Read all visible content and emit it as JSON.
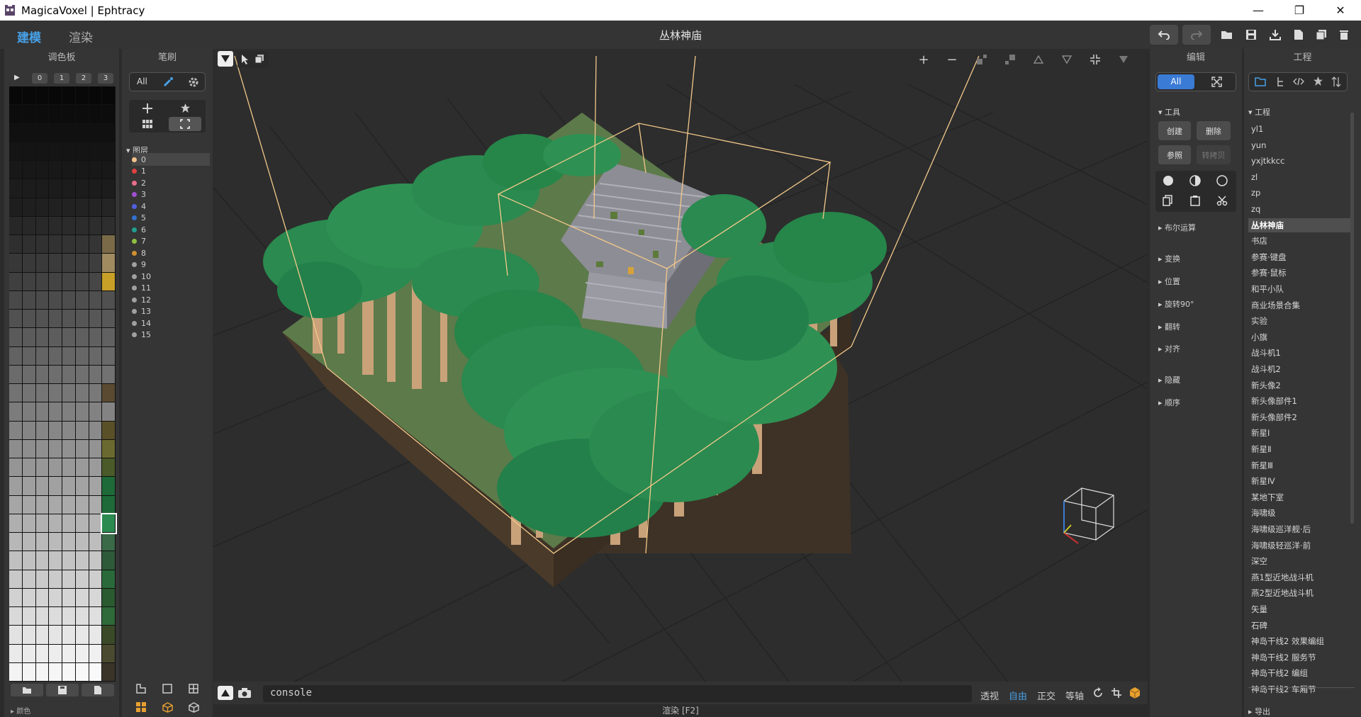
{
  "window": {
    "title": "MagicaVoxel | Ephtracy",
    "minimize": "—",
    "restore": "❐",
    "close": "✕"
  },
  "header": {
    "mode_model": "建模",
    "mode_render": "渲染",
    "project_title": "丛林神庙"
  },
  "palette": {
    "title": "调色板",
    "play": "▶",
    "pages": [
      "0",
      "1",
      "2",
      "3"
    ],
    "footer_label": "▸ 颜色"
  },
  "brush": {
    "title": "笔刷",
    "all": "All",
    "layers_title": "▾ 图层",
    "layers": [
      {
        "label": "0",
        "color": "#f2c28a"
      },
      {
        "label": "1",
        "color": "#e04040"
      },
      {
        "label": "2",
        "color": "#e86e8a"
      },
      {
        "label": "3",
        "color": "#a050d0"
      },
      {
        "label": "4",
        "color": "#5060e0"
      },
      {
        "label": "5",
        "color": "#3070d0"
      },
      {
        "label": "6",
        "color": "#20a090"
      },
      {
        "label": "7",
        "color": "#90c040"
      },
      {
        "label": "8",
        "color": "#d09030"
      },
      {
        "label": "9",
        "color": "#a0a0a0"
      },
      {
        "label": "10",
        "color": "#a0a0a0"
      },
      {
        "label": "11",
        "color": "#a0a0a0"
      },
      {
        "label": "12",
        "color": "#a0a0a0"
      },
      {
        "label": "13",
        "color": "#a0a0a0"
      },
      {
        "label": "14",
        "color": "#a0a0a0"
      },
      {
        "label": "15",
        "color": "#a0a0a0"
      }
    ]
  },
  "viewport": {
    "console_value": "console",
    "render_hint": "渲染 [F2]",
    "view_modes": [
      "透视",
      "自由",
      "正交",
      "等轴"
    ],
    "active_view_mode": "自由"
  },
  "edit": {
    "title": "编辑",
    "all": "All",
    "tools_title": "▾ 工具",
    "create": "创建",
    "delete": "删除",
    "reference": "参照",
    "convert": "转拷贝",
    "sections": [
      "▸ 布尔运算",
      "▸ 变换",
      "▸ 位置",
      "▸ 旋转90°",
      "▸ 翻转",
      "▸ 对齐",
      "▸ 隐藏",
      "▸ 顺序"
    ]
  },
  "project": {
    "title": "工程",
    "section_title": "▾ 工程",
    "export_label": "▸ 导出",
    "selected": "丛林神庙",
    "items": [
      "yl1",
      "yun",
      "yxjtkkcc",
      "zl",
      "zp",
      "zq",
      "丛林神庙",
      "书店",
      "参赛·键盘",
      "参赛·鼠标",
      "和平小队",
      "商业场景合集",
      "实验",
      "小旗",
      "战斗机1",
      "战斗机2",
      "新头像2",
      "新头像部件1",
      "新头像部件2",
      "新星Ⅰ",
      "新星Ⅱ",
      "新星Ⅲ",
      "新星Ⅳ",
      "某地下室",
      "海啸级",
      "海啸级巡洋舰·后",
      "海啸级轻巡洋·前",
      "深空",
      "燕1型近地战斗机",
      "燕2型近地战斗机",
      "矢量",
      "石碑",
      "神岛干线2 效果编组",
      "神岛干线2 服务节",
      "神岛干线2 编组",
      "神岛干线2 车厢节"
    ]
  },
  "colors": {
    "accent": "#48a0e6",
    "panel": "#353535",
    "viewport": "#2d2d2d",
    "foliage": "#2e8b4e",
    "trunk": "#c9a27a",
    "ground": "#5d7a4a",
    "selection_box": "#f3c98b"
  }
}
